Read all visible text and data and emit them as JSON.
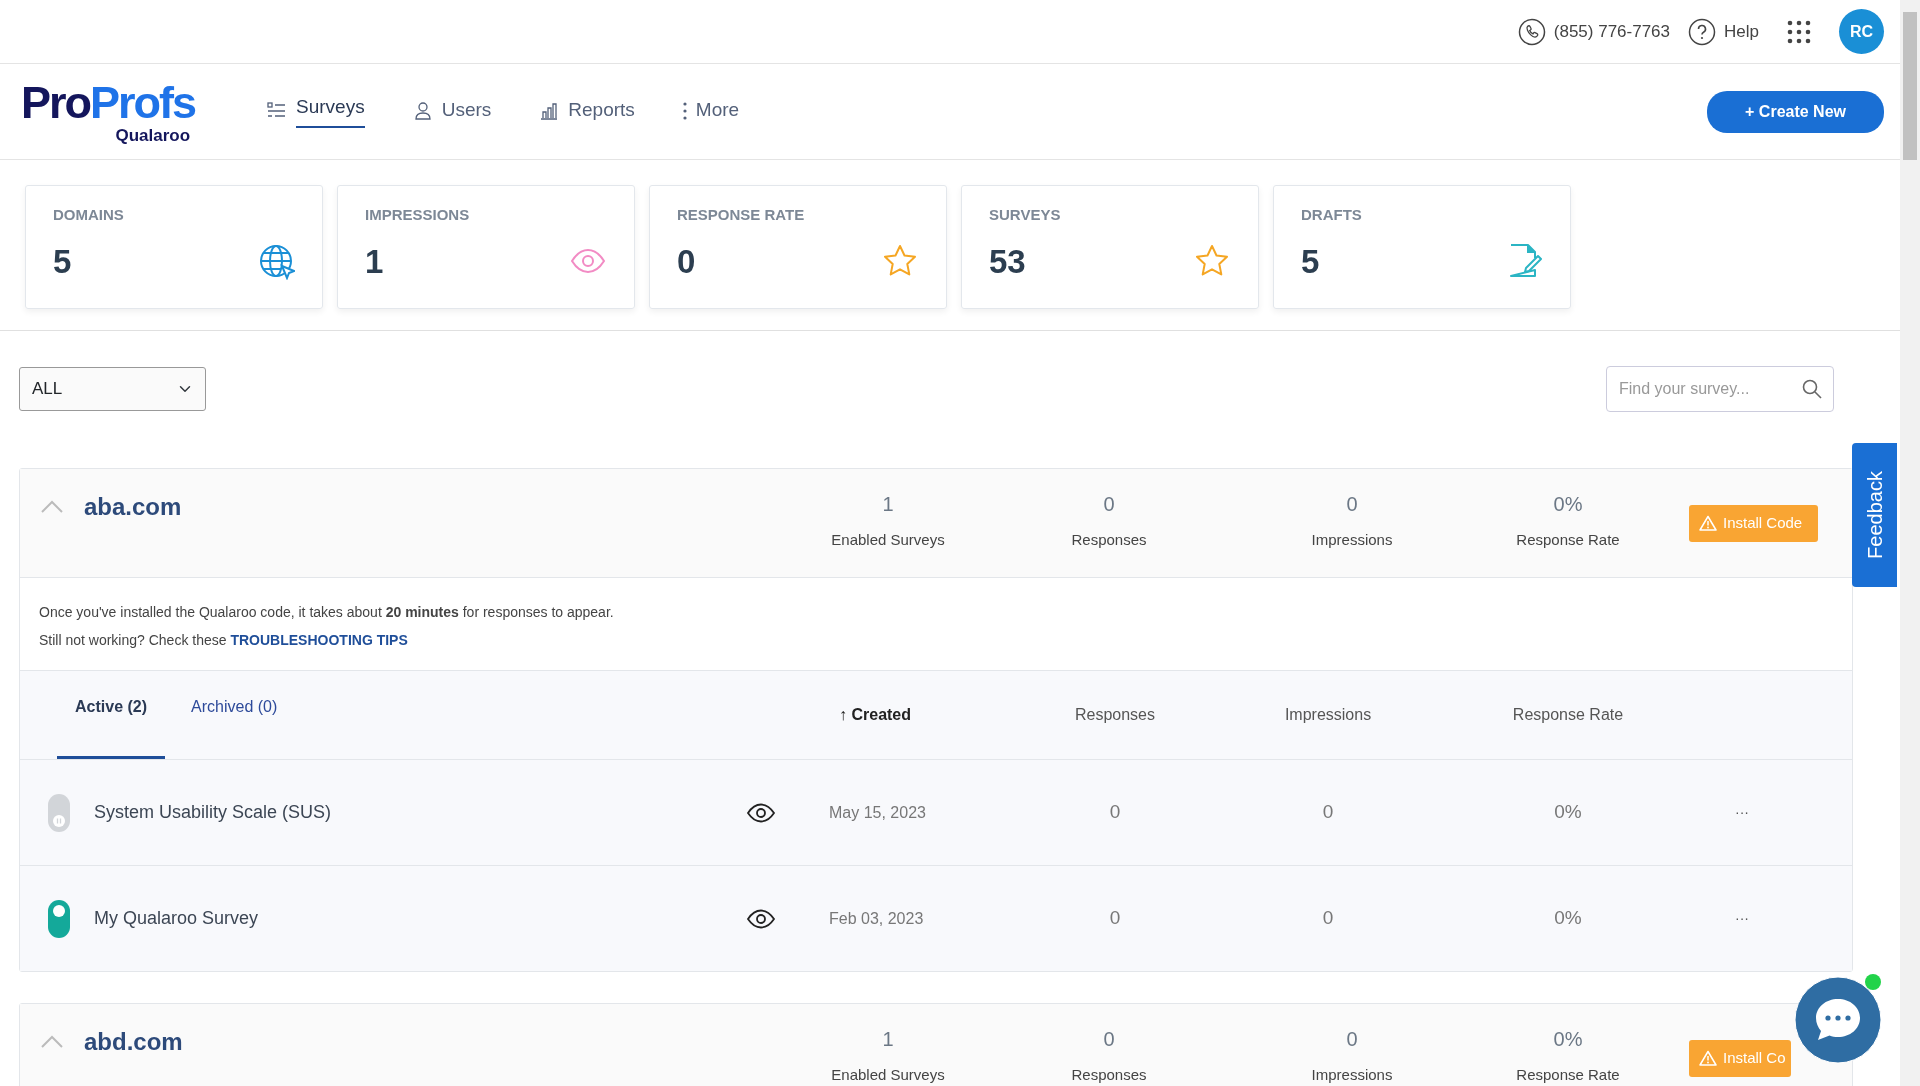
{
  "topbar": {
    "phone": "(855) 776-7763",
    "help": "Help",
    "avatar": "RC"
  },
  "logo": {
    "brand_parts": [
      "Pro",
      "Profs"
    ],
    "product": "Qualaroo"
  },
  "nav": [
    {
      "label": "Surveys",
      "kind": "surveys",
      "selected": true
    },
    {
      "label": "Users",
      "kind": "users",
      "selected": false
    },
    {
      "label": "Reports",
      "kind": "reports",
      "selected": false
    },
    {
      "label": "More",
      "kind": "more",
      "selected": false
    }
  ],
  "create_button": "+ Create New",
  "stats": [
    {
      "label": "DOMAINS",
      "value": "5",
      "kind": "globe"
    },
    {
      "label": "IMPRESSIONS",
      "value": "1",
      "kind": "eye"
    },
    {
      "label": "RESPONSE RATE",
      "value": "0",
      "kind": "star"
    },
    {
      "label": "SURVEYS",
      "value": "53",
      "kind": "star"
    },
    {
      "label": "DRAFTS",
      "value": "5",
      "kind": "draft"
    }
  ],
  "filter": {
    "value": "ALL"
  },
  "search": {
    "placeholder": "Find your survey..."
  },
  "domains": [
    {
      "name": "aba.com",
      "expanded": true,
      "stats": [
        {
          "value": "1",
          "label": "Enabled Surveys"
        },
        {
          "value": "0",
          "label": "Responses"
        },
        {
          "value": "0",
          "label": "Impressions"
        },
        {
          "value": "0%",
          "label": "Response Rate"
        }
      ],
      "install_button": "Install Code",
      "notice": {
        "line1": "Once you've installed the Qualaroo code, it takes about **20 minutes** for responses to appear.",
        "line2": "Still not working? Check these",
        "link": "TROUBLESHOOTING TIPS"
      },
      "tabs": [
        {
          "label": "Active (2)",
          "selected": true
        },
        {
          "label": "Archived (0)",
          "selected": false
        }
      ],
      "columns": [
        "↑ Created",
        "Responses",
        "Impressions",
        "Response Rate"
      ],
      "surveys": [
        {
          "name": "System Usability Scale (SUS)",
          "on": false,
          "created": "May 15, 2023",
          "responses": "0",
          "impressions": "0",
          "response_rate": "0%",
          "menu": "···"
        },
        {
          "name": "My Qualaroo Survey",
          "on": true,
          "created": "Feb 03, 2023",
          "responses": "0",
          "impressions": "0",
          "response_rate": "0%",
          "menu": "···"
        }
      ]
    },
    {
      "name": "abd.com",
      "expanded": true,
      "stats": [
        {
          "value": "1",
          "label": "Enabled Surveys"
        },
        {
          "value": "0",
          "label": "Responses"
        },
        {
          "value": "0",
          "label": "Impressions"
        },
        {
          "value": "0%",
          "label": "Response Rate"
        }
      ],
      "install_button": "Install Co"
    }
  ],
  "feedback": "Feedback"
}
